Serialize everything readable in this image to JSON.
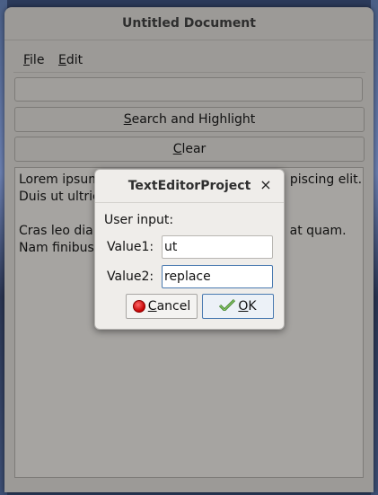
{
  "window": {
    "title": "Untitled Document",
    "menu": {
      "file": "File",
      "file_rest": "ile",
      "file_mn": "F",
      "edit": "Edit",
      "edit_rest": "dit",
      "edit_mn": "E"
    },
    "main_input_value": "",
    "search_button": {
      "mn": "S",
      "rest": "earch and Highlight",
      "label": "Search and Highlight"
    },
    "clear_button": {
      "mn": "C",
      "rest": "lear",
      "label": "Clear"
    },
    "text": {
      "line1": "Lorem ipsum",
      "line1_end": "piscing elit.",
      "line2": "Duis ut ultric",
      "line3": "Cras leo dian",
      "line3_end": "at quam.",
      "line4": "Nam finibus"
    }
  },
  "dialog": {
    "title": "TextEditorProject",
    "close_glyph": "×",
    "prompt": "User input:",
    "value1_label": "Value1:",
    "value1": "ut",
    "value2_label": "Value2:",
    "value2": "replace",
    "cancel": {
      "mn": "C",
      "rest": "ancel",
      "label": "Cancel"
    },
    "ok": {
      "mn": "O",
      "rest": "K",
      "label": "OK"
    }
  },
  "icons": {
    "cancel": "stop-circle-icon",
    "ok": "checkmark-arrow-icon",
    "close": "close-icon"
  },
  "colors": {
    "window_bg": "#9c9a97",
    "dialog_bg": "#efedea",
    "focus": "#4a7ab0",
    "cancel_icon": "#c40000"
  }
}
